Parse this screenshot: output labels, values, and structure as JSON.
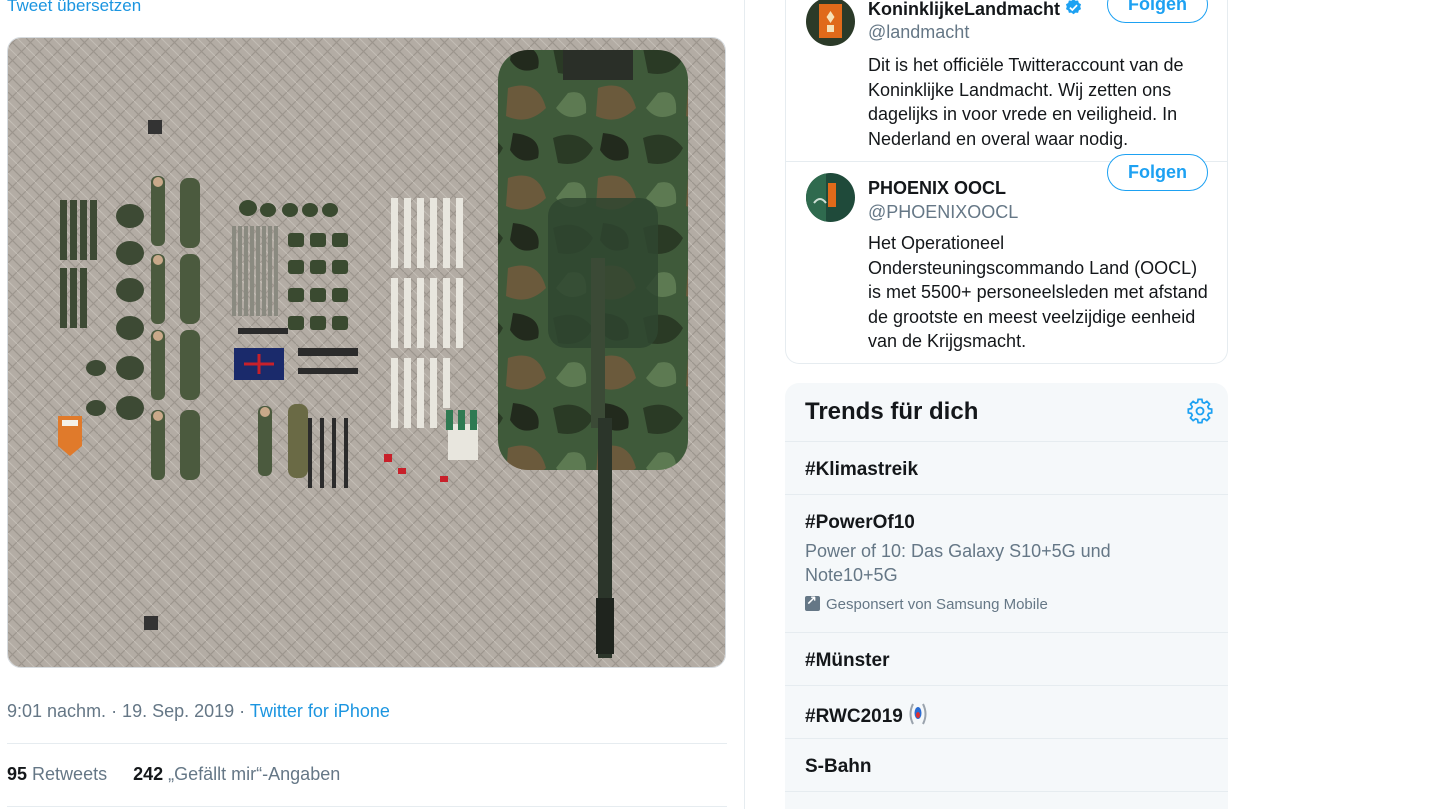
{
  "tweet": {
    "translate_label": "Tweet übersetzen",
    "timestamp": "9:01 nachm. · 19. Sep. 2019 ·",
    "source": "Twitter for iPhone",
    "retweets_count": "95",
    "retweets_label": "Retweets",
    "likes_count": "242",
    "likes_label": "„Gefällt mir“-Angaben"
  },
  "who_to_follow": {
    "accounts": [
      {
        "name": "KoninklijkeLandmacht",
        "handle": "@landmacht",
        "verified": true,
        "follow_label": "Folgen",
        "bio": "Dit is het officiële Twitteraccount van de Koninklijke Landmacht. Wij zetten ons dagelijks in voor vrede en veiligheid. In Nederland en overal waar nodig."
      },
      {
        "name": "PHOENIX OOCL",
        "handle": "@PHOENIXOOCL",
        "verified": false,
        "follow_label": "Folgen",
        "bio": "Het Operationeel Ondersteuningscommando Land (OOCL) is met 5500+ personeelsleden met afstand de grootste en meest veelzijdige eenheid van de Krijgsmacht."
      }
    ]
  },
  "trends": {
    "title": "Trends für dich",
    "items": [
      {
        "name": "#Klimastreik"
      },
      {
        "name": "#PowerOf10",
        "description": "Power of 10: Das Galaxy S10+5G und Note10+5G",
        "promoted": "Gesponsert von Samsung Mobile"
      },
      {
        "name": "#Münster"
      },
      {
        "name": "#RWC2019"
      },
      {
        "name": "S-Bahn"
      }
    ]
  },
  "colors": {
    "accent": "#1da1f2",
    "link": "#1b95e0",
    "secondary_text": "#657786",
    "trends_bg": "#f5f8fa",
    "divider": "#e6ecf0"
  },
  "icons": {
    "verified": "verified-badge-icon",
    "settings": "gear-icon",
    "promoted": "promoted-icon",
    "rwc_emoji": "rugby-world-cup-emoji-icon"
  }
}
